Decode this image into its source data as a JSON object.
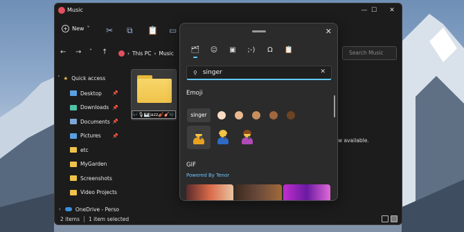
{
  "window": {
    "title": "Music",
    "min": "—",
    "max": "☐",
    "close": "✕"
  },
  "toolbar": {
    "new_label": "New",
    "new_chevron": "˅"
  },
  "navbar": {
    "back": "←",
    "forward": "→",
    "dropdown": "˅",
    "up": "↑",
    "breadcrumb_root": "This PC",
    "breadcrumb_sep": "›",
    "breadcrumb_current": "Music",
    "search_placeholder": "Search Music"
  },
  "sidebar": {
    "quick_access_label": "Quick access",
    "items": [
      {
        "label": "Desktop",
        "pinned": true,
        "icon": "desktop-icon",
        "color": "#5aa0e0"
      },
      {
        "label": "Downloads",
        "pinned": true,
        "icon": "download-icon",
        "color": "#4ec2a8"
      },
      {
        "label": "Documents",
        "pinned": true,
        "icon": "documents-icon",
        "color": "#7fa6d6"
      },
      {
        "label": "Pictures",
        "pinned": true,
        "icon": "pictures-icon",
        "color": "#5aa0e0"
      },
      {
        "label": "etc",
        "pinned": false,
        "icon": "folder-icon",
        "color": "#efc34a"
      },
      {
        "label": "MyGarden",
        "pinned": false,
        "icon": "folder-icon",
        "color": "#efc34a"
      },
      {
        "label": "Screenshots",
        "pinned": false,
        "icon": "folder-icon",
        "color": "#efc34a"
      },
      {
        "label": "Video Projects",
        "pinned": false,
        "icon": "folder-icon",
        "color": "#efc34a"
      }
    ],
    "pin_glyph": "📌",
    "onedrive_label": "OneDrive - Perso"
  },
  "content": {
    "folder_name_editing": "🎶🎙🎹Jazz🎻🎸🎼",
    "details_text": "w available."
  },
  "status": {
    "items_count": "2 items",
    "selected": "1 item selected"
  },
  "emoji_panel": {
    "close": "✕",
    "search_value": "singer",
    "search_clear": "✕",
    "emoji_section": "Emoji",
    "tone_label": "singer",
    "skin_tones": [
      "#f9dcc4",
      "#e8b98f",
      "#c9905f",
      "#a0673e",
      "#6b4424"
    ],
    "emojis": [
      {
        "name": "singer-emoji",
        "hair": "#3a3a3a",
        "body": "#e9a21f"
      },
      {
        "name": "man-singer-emoji",
        "hair": "#f4c443",
        "body": "#2c6ac4"
      },
      {
        "name": "woman-singer-emoji",
        "hair": "#8a4a1d",
        "body": "#b04ab8"
      }
    ],
    "gif_section": "GIF",
    "gif_powered": "Powered By Tenor",
    "accent": "#60cdff"
  }
}
